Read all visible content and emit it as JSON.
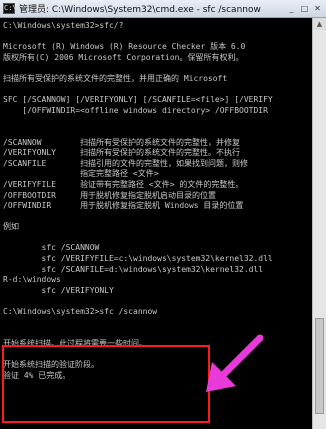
{
  "window": {
    "title": "管理员: C:\\Windows\\System32\\cmd.exe - sfc  /scannow",
    "icon_label": "C:\\",
    "controls": [
      "_",
      "□",
      "✕"
    ]
  },
  "console": {
    "lines": [
      "C:\\Windows\\system32>sfc/?",
      "",
      "Microsoft (R) Windows (R) Resource Checker 版本 6.0",
      "版权所有(C) 2006 Microsoft Corporation。保留所有权利。",
      "",
      "扫描所有受保护的系统文件的完整性，并用正确的 Microsoft",
      "",
      "SFC [/SCANNOW] [/VERIFYONLY] [/SCANFILE=<file>] [/VERIFY",
      "    [/OFFWINDIR=<offline windows directory> /OFFBOOTDIR",
      "",
      "",
      "/SCANNOW        扫描所有受保护的系统文件的完整性，并修复",
      "/VERIFYONLY     扫描所有受保护的系统文件的完整性。不执行",
      "/SCANFILE       扫描引用的文件的完整性，如果找到问题，则修",
      "                指定完整路径 <文件>",
      "/VERIFYFILE     验证带有完整路径 <文件> 的文件的完整性。",
      "/OFFBOOTDIR     用于脱机修复指定脱机启动目录的位置",
      "/OFFWINDIR      用于脱机修复指定脱机 Windows 目录的位置",
      "",
      "例如",
      "",
      "        sfc /SCANNOW",
      "        sfc /VERIFYFILE=c:\\windows\\system32\\kernel32.dll",
      "        sfc /SCANFILE=d:\\windows\\system32\\kernel32.dll",
      "R-d:\\windows",
      "        sfc /VERIFYONLY",
      "",
      "C:\\Windows\\system32>sfc /scannow",
      "",
      "",
      "开始系统扫描。此过程将需要一些时间。",
      "",
      "开始系统扫描的验证阶段。",
      "验证 4% 已完成。"
    ]
  },
  "colors": {
    "console_text": "#c8c8c8",
    "console_bg": "#000000",
    "highlight": "#ff1a1a",
    "arrow": "#e83ad9"
  },
  "icons": {
    "annotation_arrow": "arrow-pointing-to-highlight",
    "scroll_up": "chevron-up-icon",
    "scroll_down": "chevron-down-icon"
  }
}
